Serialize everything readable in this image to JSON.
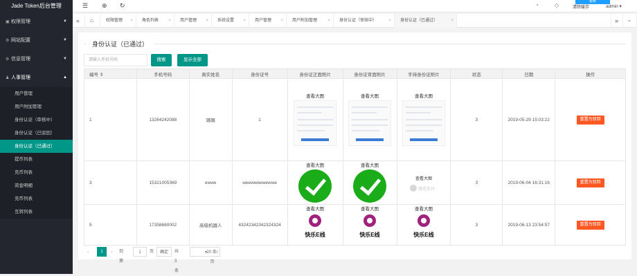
{
  "app": {
    "title": "Jade Token后台管理"
  },
  "sidebar": {
    "groups": [
      {
        "label": "权限管理"
      },
      {
        "label": "网站配置"
      },
      {
        "label": "信息管理"
      },
      {
        "label": "人事管理"
      }
    ],
    "items": [
      {
        "label": "用户管理"
      },
      {
        "label": "用户附加管理"
      },
      {
        "label": "身份认证（审核中）"
      },
      {
        "label": "身份认证（已驳回）"
      },
      {
        "label": "身份认证（已通过）"
      },
      {
        "label": "提币列表"
      },
      {
        "label": "充币列表"
      },
      {
        "label": "资金明细"
      },
      {
        "label": "充币列表"
      },
      {
        "label": "互转列表"
      }
    ]
  },
  "topbar": {
    "user": "admin",
    "pill": "更新",
    "extra": "清除缓存"
  },
  "tabs": [
    {
      "label": "权限管理"
    },
    {
      "label": "角色列表"
    },
    {
      "label": "用户管理"
    },
    {
      "label": "系统设置"
    },
    {
      "label": "用户管理"
    },
    {
      "label": "用户附加管理"
    },
    {
      "label": "身份认证（审核中）"
    },
    {
      "label": "身份认证（已通过）"
    }
  ],
  "page": {
    "legend": "身份认证（已通过）",
    "search_placeholder": "请输入手机号码",
    "search_btn": "搜索",
    "show_all_btn": "显示全部"
  },
  "table": {
    "headers": [
      "编号",
      "手机号码",
      "真实姓名",
      "身份证号",
      "身份证正面照片",
      "身份证背面照片",
      "手持身份证照片",
      "状态",
      "日期",
      "操作"
    ],
    "view_label": "查看大图",
    "wechat_label": "微信支付",
    "brand_label": "快乐E线",
    "action_label": "重置为驳回",
    "rows": [
      {
        "id": "1",
        "phone": "13264242088",
        "name": "璐璐",
        "idno": "1",
        "status": "3",
        "date": "2019-05-29 15:03:22"
      },
      {
        "id": "3",
        "phone": "15321005369",
        "name": "ewwe",
        "idno": "weewweewewwe",
        "status": "3",
        "date": "2019-06-04 16:31:16"
      },
      {
        "id": "5",
        "phone": "17358680002",
        "name": "高级机器人",
        "idno": "43242342342324324",
        "status": "3",
        "date": "2019-06-13 23:54:57"
      }
    ]
  },
  "pager": {
    "page": "1",
    "goto_label": "到第",
    "goto_value": "1",
    "page_unit": "页",
    "confirm": "确定",
    "total": "共 3 条",
    "per_page": "20 条/页"
  }
}
